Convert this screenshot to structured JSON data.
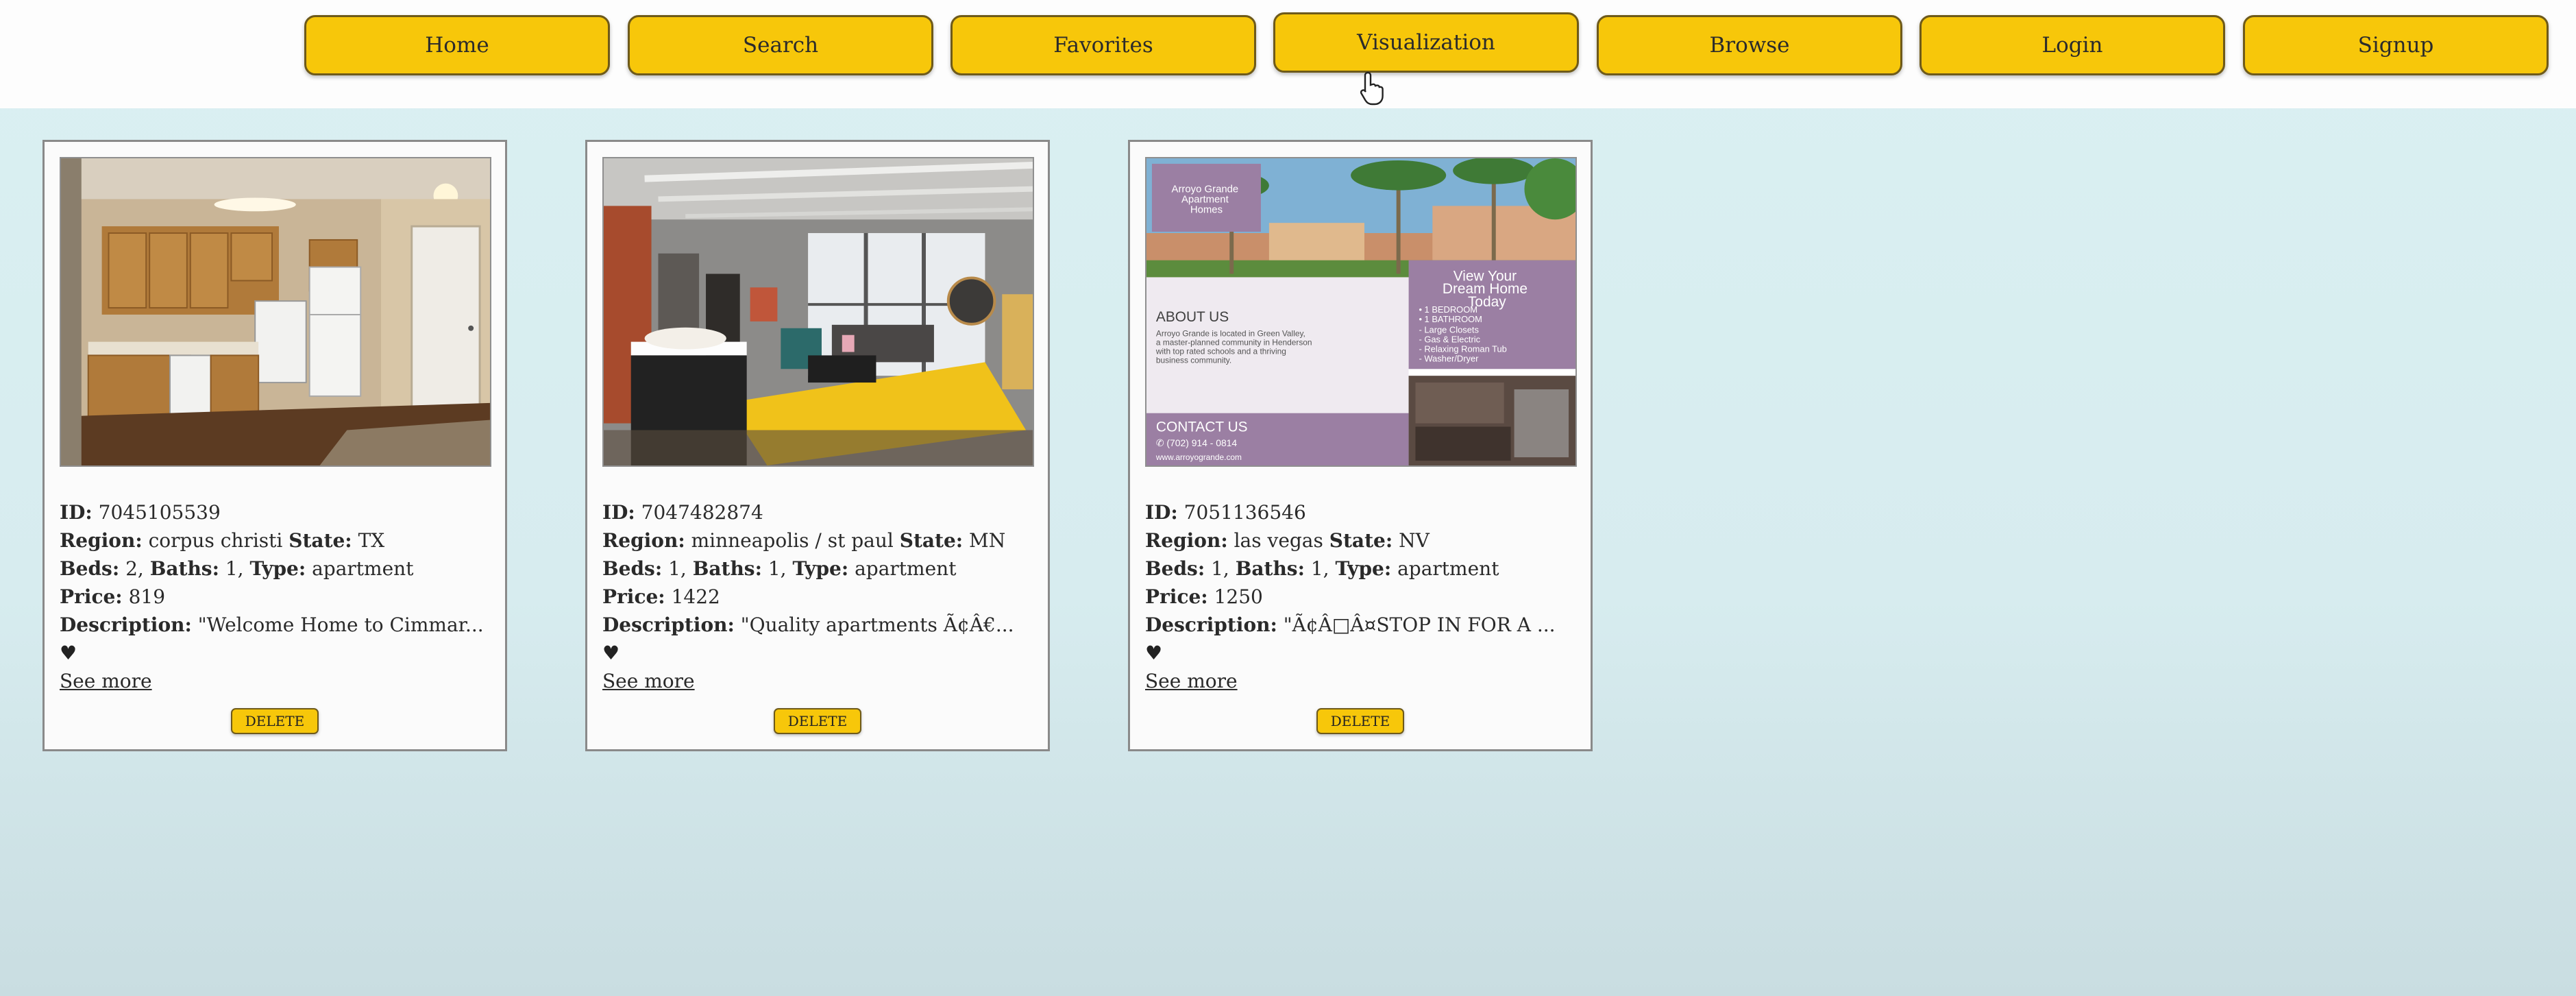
{
  "nav": {
    "home": "Home",
    "search": "Search",
    "favorites": "Favorites",
    "visualization": "Visualization",
    "browse": "Browse",
    "login": "Login",
    "signup": "Signup"
  },
  "colors": {
    "nav_button": "#f7c70a",
    "page_background": "#daf0f2"
  },
  "labels": {
    "id": "ID:",
    "region": "Region:",
    "state": "State:",
    "beds": "Beds:",
    "baths": "Baths:",
    "type": "Type:",
    "price": "Price:",
    "description": "Description:",
    "see_more": "See more",
    "delete": "DELETE",
    "heart": "♥"
  },
  "listings": [
    {
      "id": "7045105539",
      "region": "corpus christi",
      "state": "TX",
      "beds": "2,",
      "baths": "1,",
      "type": "apartment",
      "price": "819",
      "description": "\"Welcome Home to Cimmar..."
    },
    {
      "id": "7047482874",
      "region": "minneapolis / st paul",
      "state": "MN",
      "beds": "1,",
      "baths": "1,",
      "type": "apartment",
      "price": "1422",
      "description": "\"Quality apartments Ã¢Â€..."
    },
    {
      "id": "7051136546",
      "region": "las vegas",
      "state": "NV",
      "beds": "1,",
      "baths": "1,",
      "type": "apartment",
      "price": "1250",
      "description": "\"Ã¢Â□Â¤STOP IN FOR A ...",
      "flyer": {
        "brand": "Arroyo Grande Apartment Homes",
        "headline": "View Your Dream Home Today",
        "features": [
          "1 BEDROOM",
          "1 BATHROOM",
          "Large Closets",
          "Gas & Electric",
          "Relaxing Roman Tub",
          "Washer/Dryer"
        ],
        "about_heading": "ABOUT US",
        "about_text": "Arroyo Grande is located in Green Valley, a master-planned community in Henderson with top rated schools and a thriving business community.",
        "contact_heading": "CONTACT US",
        "phone": "(702) 914 - 0814",
        "website": "www.arroyogrande.com"
      }
    }
  ]
}
